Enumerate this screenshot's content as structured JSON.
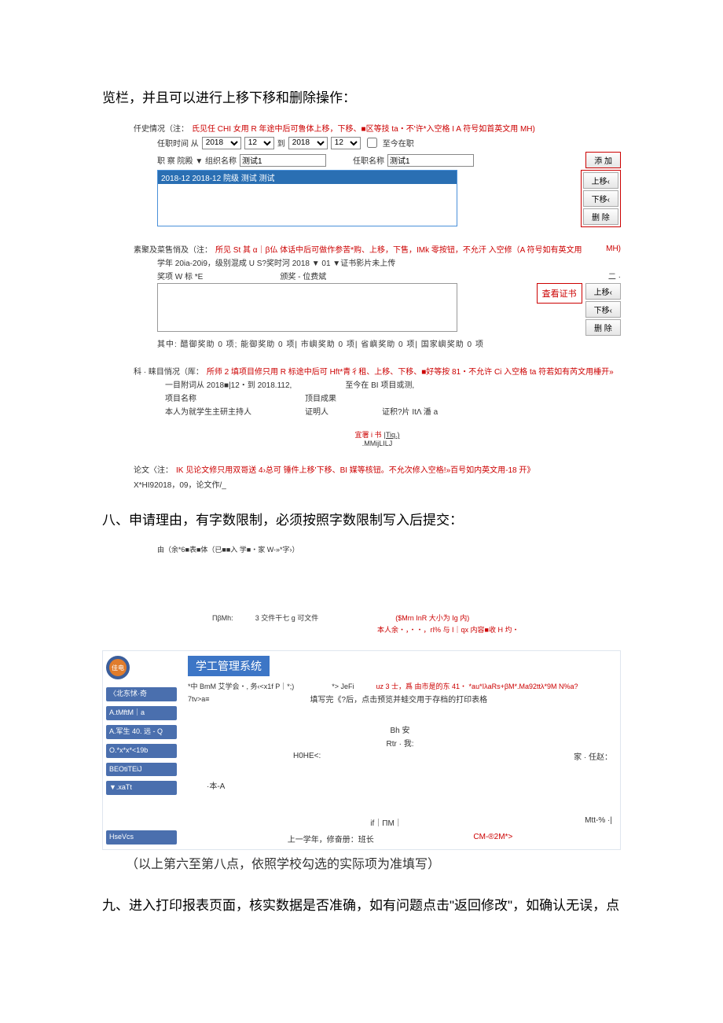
{
  "intro_heading": "览栏，并且可以进行上移下移和删除操作：",
  "emp": {
    "title_prefix": "仟史情况（注：",
    "title_red": "氏见任 CHI 女用 R 年途中后可鲁体上移，下移、■区等技 ta・不'许*入空格 I A 符号如首英文用  MH)",
    "row_label": "任职时间 从",
    "year1": "2018",
    "mon1": "12",
    "to": "到",
    "year2": "2018",
    "mon2": "12",
    "chk_label": "至今在职",
    "pos_label": "职    察 院殿 ▼ 组织名称",
    "pos_val": "测试1",
    "name_label": "任职名称",
    "name_val": "测试1",
    "btn_add": "添 加",
    "list_sel": "2018-12 2018-12 院级 测试 测试",
    "btn_up": "上移‹",
    "btn_down": "下移‹",
    "btn_del": "删 除"
  },
  "award": {
    "title_prefix": "素聚及菜售悄及（注：",
    "title_red": "所见 St 其 α｜β仏 体话中后可做作参苦*购、上移，下售，IMk 零按钮，不允汗 入空修（A 符号如有英文用",
    "title_suffix_red": "MH)",
    "line2": "学年 20ia-20i9，级别混成 U S?奖时河 2018 ▼ 01 ▼证书影片未上传",
    "line3a": "奖项 W 标   *E",
    "line3b": "颁奖 - 位费斌",
    "line3c": "二 ·",
    "btn_view_cert": "査看证书",
    "btn_up": "上移‹",
    "btn_down": "下移‹",
    "btn_del": "删 除",
    "counts": "其中: 醋御奖助 0     项; 能御奖助 0     项| 市嶼奖助 0     项| 省嶼奖助 0     项| 国家嶼奖助 0     项"
  },
  "proj": {
    "title_prefix": "科 · 睐目悄况（厍：",
    "title_red": "所师 2 填项目修只用 R 标途中后可 Hft*青彳租、上移、下移、■好等按 81・不允许 Ci 入空格 ta 符若如有芮文用棰开»",
    "r1": "一目附词从 2018■|12・到 2018.112,",
    "r1b": "至今在 BI 项目或测,",
    "r2a": "项目名称",
    "r2b": "顶目成果",
    "r3a": "本人为就学生主研主持人",
    "r3b": "证明人",
    "r3c": "证积?片 ItΛ 潘 a",
    "center1_red": "宜署 i 书",
    "center1_link": "|Tiq.)",
    "center2": ".MMijLILJ"
  },
  "paper": {
    "prefix": "论文〈注：",
    "red": "IK 见论文修只用双哥送 4›总可 锤件上移'下移、BI 媒等核钮。不允次修入空格!»百号如内英文用-18 开》",
    "suffix": "X*HI92018，09，论文作/_"
  },
  "sec8": {
    "heading": "八、申请理由，有字数限制，必须按照字数限制写入后提交：",
    "l1": "由（余*6■表■体（已■■入                     学■・家 W-»*字›）",
    "l2a": "ΠβMh:",
    "l2b": "3 交件干七 g 可文件",
    "l2c_red": "($Mrn InR 大小为 Ig 内)",
    "l3_red": "本人余・，・・，rI% 与 I｜qx 内容■收 H 圴・"
  },
  "app": {
    "logo_text": "佳电",
    "title": "学工管理系统",
    "side1": "〈北东怵·奇",
    "side2": "A.tMftM｜a",
    "side3": "A.军生 40. 远 - Q",
    "side4": "O.*x*x*<19b",
    "side5": "BEOtiTEiJ",
    "side6": "▼.xaTt",
    "side7": "HseVcs",
    "line1a": "*中 BmM 艾学会・, 务‹<x1f P｜*;)",
    "line1b": "*> JeFi",
    "line1c_red": "uz  3 士，爲 由市是的东 41・ *au*IλaRs+βM*.Ma92ttλ*9M N%a?",
    "line2": "7tv>a≡",
    "greet": "填写完《?后，点击预览并蛙交用于存档的打印表格",
    "bh": "Bh 安",
    "rtr": "Rtr · 我:",
    "home": "H0HE<:",
    "home_right": "家 · 任赵：",
    "ba": "·本-A",
    "foot_c": "if｜ΠM｜",
    "foot_r": "Mtt-% ·|",
    "foot2a": "上一学年，修奋册：班长",
    "foot2b_red": "CM-®2M*>"
  },
  "below_app": "（以上第六至第八点，依照学校勾选的实际项为准填写）",
  "sec9": "九、进入打印报表页面，核实数据是否准确，如有问题点击\"返回修改\"，如确认无误，点"
}
